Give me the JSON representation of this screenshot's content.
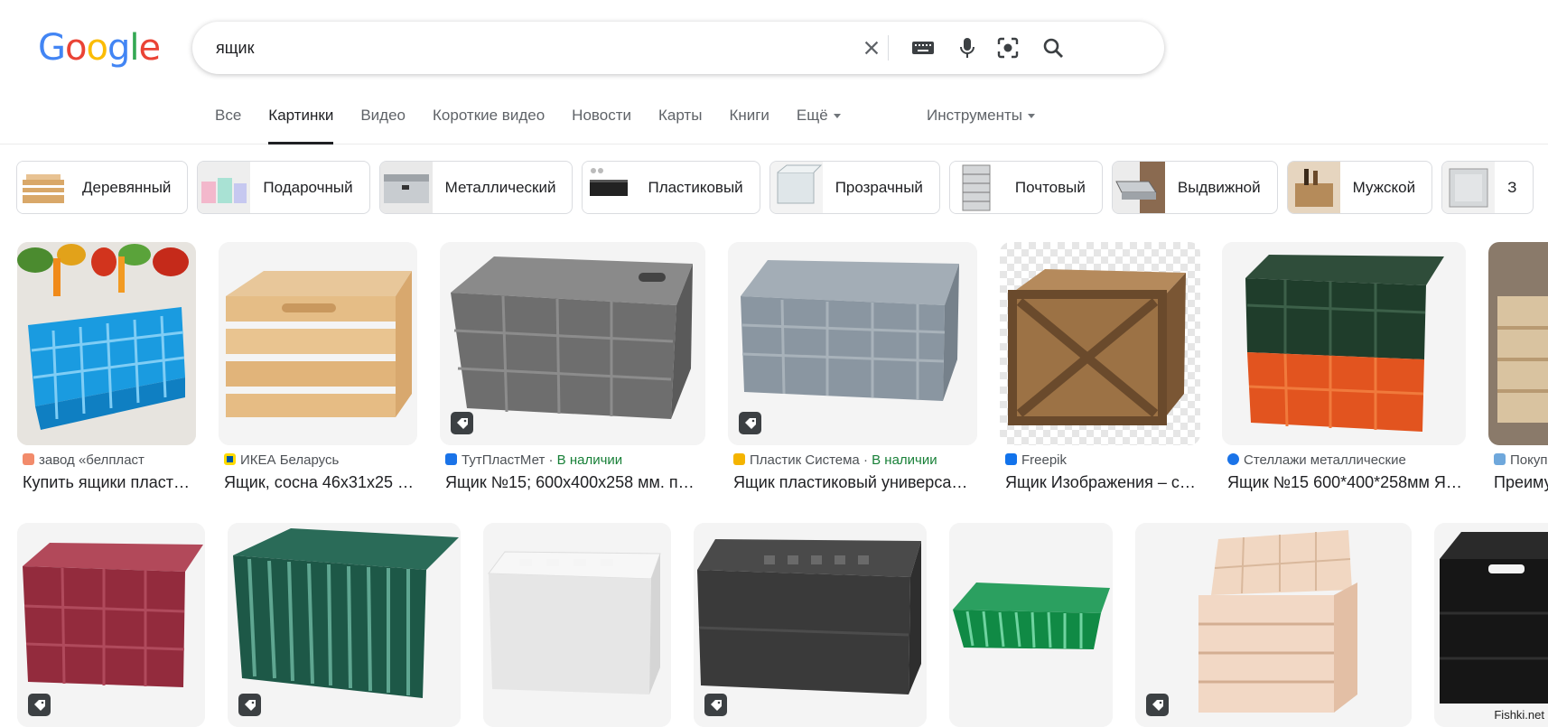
{
  "logo": {
    "letters": [
      "G",
      "o",
      "o",
      "g",
      "l",
      "e"
    ],
    "colors": [
      "#4285F4",
      "#EA4335",
      "#FBBC05",
      "#4285F4",
      "#34A853",
      "#EA4335"
    ]
  },
  "search": {
    "query": "ящик",
    "placeholder": ""
  },
  "icons": {
    "clear": "close-icon",
    "keyboard": "keyboard-icon",
    "voice": "mic-icon",
    "lens": "lens-icon",
    "search": "search-icon"
  },
  "tabs": [
    {
      "label": "Все",
      "active": false
    },
    {
      "label": "Картинки",
      "active": true
    },
    {
      "label": "Видео",
      "active": false
    },
    {
      "label": "Короткие видео",
      "active": false
    },
    {
      "label": "Новости",
      "active": false
    },
    {
      "label": "Карты",
      "active": false
    },
    {
      "label": "Книги",
      "active": false
    },
    {
      "label": "Ещё",
      "active": false
    }
  ],
  "tools_label": "Инструменты",
  "chips": [
    "Деревянный",
    "Подарочный",
    "Металлический",
    "Пластиковый",
    "Прозрачный",
    "Почтовый",
    "Выдвижной",
    "Мужской",
    "З"
  ],
  "results_row1": [
    {
      "source": "завод «белпласт",
      "in_stock": "",
      "title": "Купить ящики пласт…",
      "tag": false
    },
    {
      "source": "ИКЕА Беларусь",
      "in_stock": "",
      "title": "Ящик, сосна 46x31x25 …",
      "tag": false
    },
    {
      "source": "ТутПластМет",
      "in_stock": "В наличии",
      "title": "Ящик №15; 600х400х258 мм. п…",
      "tag": true
    },
    {
      "source": "Пластик Система",
      "in_stock": "В наличии",
      "title": "Ящик пластиковый универса…",
      "tag": true
    },
    {
      "source": "Freepik",
      "in_stock": "",
      "title": "Ящик Изображения – с…",
      "tag": false
    },
    {
      "source": "Стеллажи металлические",
      "in_stock": "",
      "title": "Ящик №15 600*400*258мм Я…",
      "tag": false
    },
    {
      "source": "Покуп",
      "in_stock": "",
      "title": "Преиму",
      "tag": false
    }
  ],
  "results_row2_tags": [
    true,
    true,
    false,
    true,
    false,
    true,
    false
  ],
  "stock_separator": "·",
  "watermark": "Fishki.net",
  "colors": {
    "tab_active": "#202124",
    "stock_green": "#188038",
    "text_muted": "#5f6368"
  }
}
